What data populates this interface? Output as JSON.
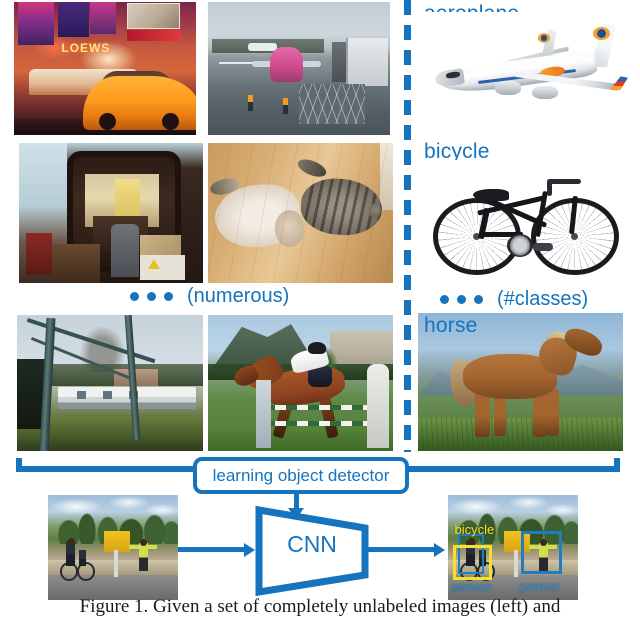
{
  "figure": {
    "caption": "Figure 1. Given a set of completely unlabeled images (left) and"
  },
  "colors": {
    "accent_blue": "#1574bd",
    "detection_person": "#1f7ec2",
    "detection_bicycle": "#f5e02a"
  },
  "left_panel": {
    "name": "unlabeled-image-collection",
    "images": [
      {
        "id": "times-square",
        "alt": "Night city street with neon LOEWS marquee, bus and yellow taxi"
      },
      {
        "id": "airport",
        "alt": "Airport apron with a pink-nosed airplane and jet bridge"
      },
      {
        "id": "interior",
        "alt": "Dark wooden dining-room interior seen through an arch"
      },
      {
        "id": "cats",
        "alt": "Two cats lying on a light wooden floor"
      },
      {
        "id": "train",
        "alt": "Passenger train behind metal poles and grass"
      },
      {
        "id": "horse-rider",
        "alt": "Rider on a brown horse jumping an obstacle"
      }
    ],
    "ellipsis": {
      "dots": 3,
      "label": "(numerous)"
    },
    "loews_sign": "LOEWS"
  },
  "right_panel": {
    "name": "class-exemplars",
    "classes": [
      {
        "label": "aeroplane",
        "alt": "White passenger jet model on white background"
      },
      {
        "label": "bicycle",
        "alt": "Black hybrid bicycle on white background"
      },
      {
        "label": "horse",
        "alt": "Brown horse standing on a grassy ridge with mountains behind"
      }
    ],
    "ellipsis": {
      "dots": 3,
      "label": "(#classes)"
    }
  },
  "divider": {
    "name": "dashed-vertical-divider",
    "style": "dashed",
    "color": "#1574bd"
  },
  "pipeline": {
    "bracket_label": "learning object detector",
    "model_label": "CNN",
    "input_image_alt": "Roadside photo with a cyclist, a yellow sign and a person with arms outstretched",
    "output_image_alt": "Same roadside photo with predicted detection boxes",
    "detections": [
      {
        "label": "bicycle",
        "color": "#f5e02a",
        "position": "above-left-box"
      },
      {
        "label": "person",
        "color": "#1f7ec2",
        "position": "below-left-box"
      },
      {
        "label": "person",
        "color": "#1f7ec2",
        "position": "below-right-box"
      }
    ]
  }
}
